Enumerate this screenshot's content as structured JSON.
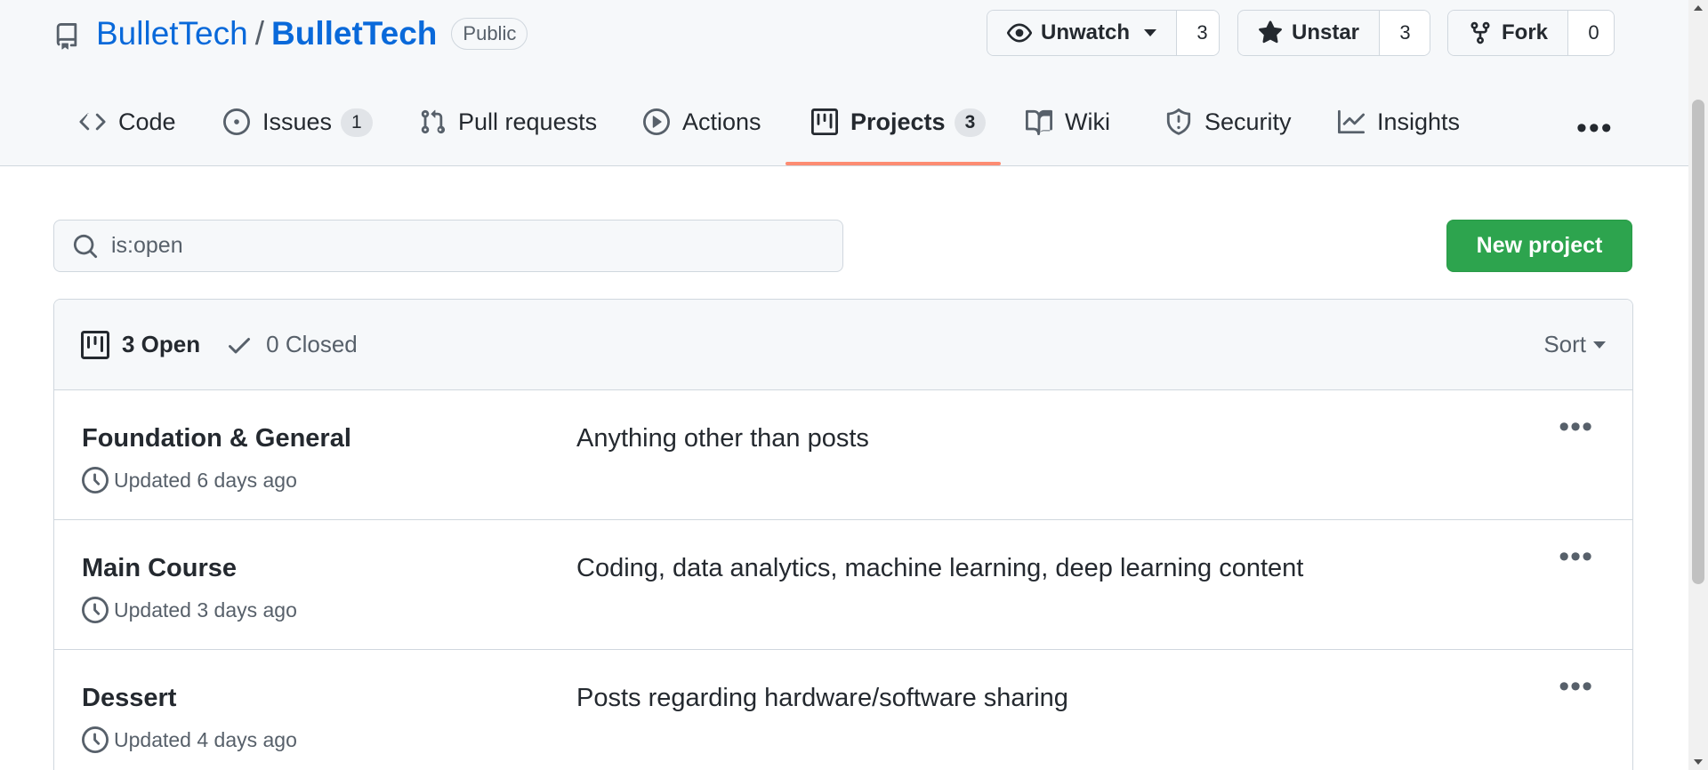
{
  "repo": {
    "owner": "BulletTech",
    "separator": "/",
    "name": "BulletTech",
    "visibility": "Public"
  },
  "actions": {
    "watch": {
      "label": "Unwatch",
      "count": "3"
    },
    "star": {
      "label": "Unstar",
      "count": "3"
    },
    "fork": {
      "label": "Fork",
      "count": "0"
    }
  },
  "tabs": [
    {
      "label": "Code",
      "icon": "code-icon"
    },
    {
      "label": "Issues",
      "icon": "issue-icon",
      "count": "1"
    },
    {
      "label": "Pull requests",
      "icon": "pull-request-icon"
    },
    {
      "label": "Actions",
      "icon": "play-icon"
    },
    {
      "label": "Projects",
      "icon": "project-icon",
      "count": "3",
      "active": true
    },
    {
      "label": "Wiki",
      "icon": "book-icon"
    },
    {
      "label": "Security",
      "icon": "shield-icon"
    },
    {
      "label": "Insights",
      "icon": "graph-icon"
    }
  ],
  "search": {
    "value": "is:open"
  },
  "new_project_label": "New project",
  "filters": {
    "open": "3 Open",
    "closed": "0 Closed",
    "sort": "Sort"
  },
  "projects": [
    {
      "title": "Foundation & General",
      "updated": "Updated 6 days ago",
      "description": "Anything other than posts"
    },
    {
      "title": "Main Course",
      "updated": "Updated 3 days ago",
      "description": "Coding, data analytics, machine learning, deep learning content"
    },
    {
      "title": "Dessert",
      "updated": "Updated 4 days ago",
      "description": "Posts regarding hardware/software sharing"
    }
  ],
  "colors": {
    "link": "#0969da",
    "primary_button": "#2da44e",
    "active_tab_underline": "#fd8c73",
    "header_bg": "#f6f8fa"
  }
}
